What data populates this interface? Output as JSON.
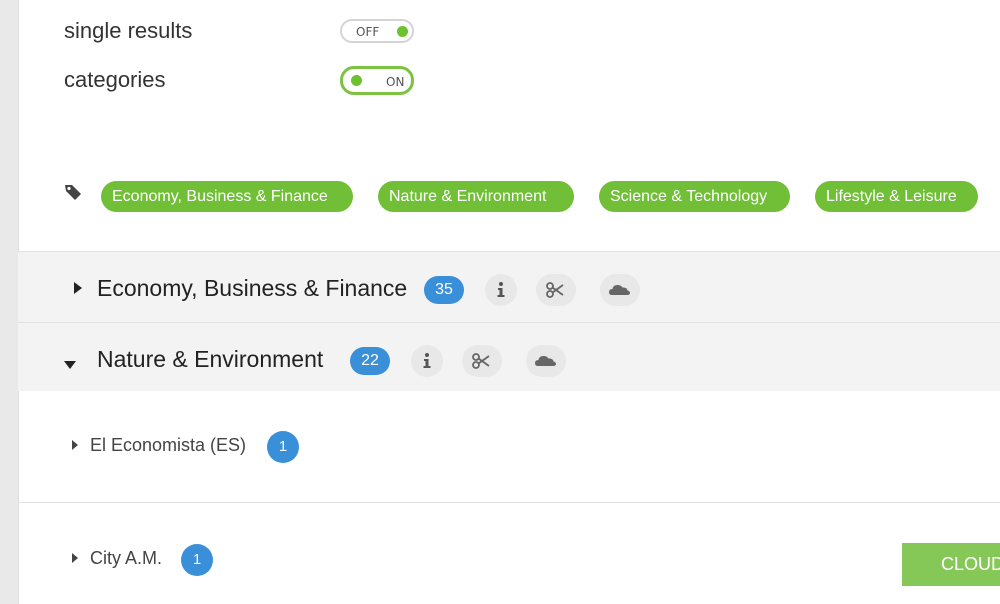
{
  "options": [
    {
      "label": "single results",
      "toggle": "OFF",
      "state": "off"
    },
    {
      "label": "categories",
      "toggle": "ON",
      "state": "on"
    }
  ],
  "tags": {
    "icon": "tag-icon",
    "chips": [
      "Economy, Business & Finance",
      "Nature & Environment",
      "Science & Technology",
      "Lifestyle & Leisure"
    ]
  },
  "categories": [
    {
      "title": "Economy, Business & Finance",
      "count": "35",
      "expanded": false
    },
    {
      "title": "Nature & Environment",
      "count": "22",
      "expanded": true
    }
  ],
  "sources": [
    {
      "name": "El Economista (ES)",
      "count": "1"
    },
    {
      "name": "City A.M.",
      "count": "1"
    }
  ],
  "actions": {
    "cloud_label": "CLOUD"
  },
  "colors": {
    "accent_green": "#70bf36",
    "count_blue": "#3a8fd9"
  },
  "icons": [
    "info-icon",
    "scissors-icon",
    "cloud-icon"
  ]
}
